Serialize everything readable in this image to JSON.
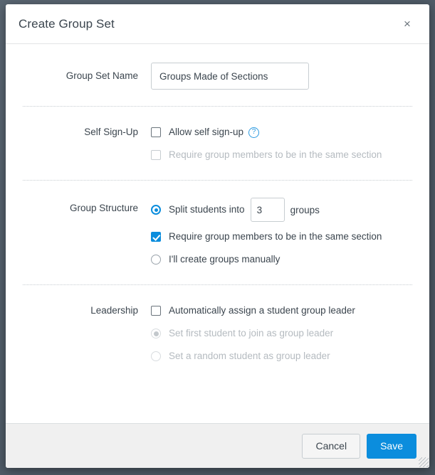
{
  "dialog": {
    "title": "Create Group Set",
    "close_label": "×",
    "close_icon": "close-icon",
    "resize_icon": "resize-grip-icon"
  },
  "group_set_name": {
    "label": "Group Set Name",
    "value": "Groups Made of Sections",
    "placeholder": ""
  },
  "self_signup": {
    "label": "Self Sign-Up",
    "allow": {
      "text": "Allow self sign-up",
      "checked": false,
      "help_icon": "help-circle-icon",
      "help_glyph": "?"
    },
    "require_same_section": {
      "text": "Require group members to be in the same section",
      "checked": false,
      "disabled": true
    }
  },
  "group_structure": {
    "label": "Group Structure",
    "split": {
      "text_before": "Split students into",
      "value": "3",
      "text_after": "groups",
      "selected": true
    },
    "require_same_section": {
      "text": "Require group members to be in the same section",
      "checked": true
    },
    "manual": {
      "text": "I'll create groups manually",
      "selected": false
    }
  },
  "leadership": {
    "label": "Leadership",
    "auto_assign": {
      "text": "Automatically assign a student group leader",
      "checked": false
    },
    "first_student": {
      "text": "Set first student to join as group leader",
      "selected": true,
      "disabled": true
    },
    "random_student": {
      "text": "Set a random student as group leader",
      "selected": false,
      "disabled": true
    }
  },
  "footer": {
    "cancel_label": "Cancel",
    "save_label": "Save"
  },
  "colors": {
    "accent": "#0b8ddd",
    "help_blue": "#2c9ae0",
    "text": "#3b454e",
    "muted": "#b5bbc0",
    "backdrop": "#56626e"
  }
}
